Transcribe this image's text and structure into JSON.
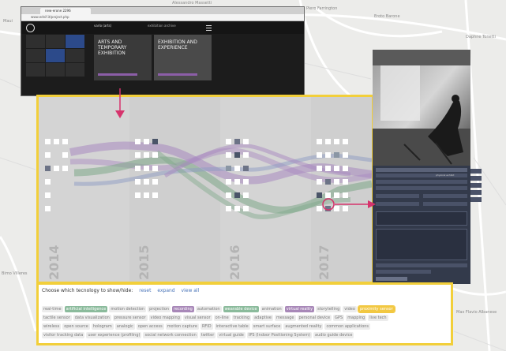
{
  "colors": {
    "highlight_yellow": "#f2cf3a",
    "pink_arrow": "#d6336c",
    "flow_purple": "#a888c0",
    "flow_green": "#7ea889",
    "flow_blue": "#8e9cc4"
  },
  "map": {
    "labels": [
      {
        "text": "Piero Farrington",
        "pos": "top-center"
      },
      {
        "text": "Eroto Barone",
        "pos": "top-right"
      },
      {
        "text": "Daphne Tonetti",
        "pos": "right"
      },
      {
        "text": "Maui",
        "pos": "left"
      },
      {
        "text": "Bimo Villeres",
        "pos": "left-middle"
      },
      {
        "text": "Max Flavio Albanese",
        "pos": "bottom-right"
      },
      {
        "text": "Alessandro Massetti",
        "pos": "top"
      }
    ]
  },
  "browser": {
    "tab_title": "new-erone 2296",
    "url": "www.ednif.it/project.php"
  },
  "site": {
    "title": "varlo (arts)",
    "subtitle": "exhibition archive",
    "features": [
      {
        "title": "ARTS AND TEMPORARY EXHIBITION"
      },
      {
        "title": "EXHIBITION AND EXPERIENCE"
      }
    ]
  },
  "viz": {
    "years": [
      "2014",
      "2015",
      "2016",
      "2017"
    ]
  },
  "detail": {
    "checkbox_label": "physical exhibit"
  },
  "filter": {
    "prompt": "Choose which tecnology to show/hide:",
    "reset": "reset",
    "expand": "expand",
    "view_all": "view all",
    "rows": [
      [
        {
          "label": "real-time",
          "state": ""
        },
        {
          "label": "artificial intelligence",
          "state": "on"
        },
        {
          "label": "motion detection",
          "state": ""
        },
        {
          "label": "projection",
          "state": ""
        },
        {
          "label": "recording",
          "state": "on-p"
        },
        {
          "label": "automation",
          "state": ""
        },
        {
          "label": "wearable device",
          "state": "on"
        },
        {
          "label": "animation",
          "state": ""
        },
        {
          "label": "virtual reality",
          "state": "on-p"
        },
        {
          "label": "storytelling",
          "state": ""
        },
        {
          "label": "video",
          "state": ""
        },
        {
          "label": "proximity sensor",
          "state": "on-y"
        }
      ],
      [
        {
          "label": "tactile sensor",
          "state": ""
        },
        {
          "label": "data visualization",
          "state": ""
        },
        {
          "label": "pressure sensor",
          "state": ""
        },
        {
          "label": "video mapping",
          "state": ""
        },
        {
          "label": "visual sensor",
          "state": ""
        },
        {
          "label": "on-line",
          "state": ""
        },
        {
          "label": "tracking",
          "state": ""
        },
        {
          "label": "adaptive",
          "state": ""
        },
        {
          "label": "message",
          "state": ""
        },
        {
          "label": "personal device",
          "state": ""
        },
        {
          "label": "GPS",
          "state": ""
        },
        {
          "label": "mapping",
          "state": ""
        },
        {
          "label": "live tech",
          "state": ""
        }
      ],
      [
        {
          "label": "wireless",
          "state": ""
        },
        {
          "label": "open source",
          "state": ""
        },
        {
          "label": "hologram",
          "state": ""
        },
        {
          "label": "analogic",
          "state": ""
        },
        {
          "label": "open access",
          "state": ""
        },
        {
          "label": "motion capture",
          "state": ""
        },
        {
          "label": "RFID",
          "state": ""
        },
        {
          "label": "interactive table",
          "state": ""
        },
        {
          "label": "smart surface",
          "state": ""
        },
        {
          "label": "augmented reality",
          "state": ""
        },
        {
          "label": "common applications",
          "state": ""
        }
      ],
      [
        {
          "label": "visitor tracking data",
          "state": ""
        },
        {
          "label": "user experience (profiling)",
          "state": ""
        },
        {
          "label": "social network connection",
          "state": ""
        },
        {
          "label": "twitter",
          "state": ""
        },
        {
          "label": "virtual guide",
          "state": ""
        },
        {
          "label": "IPS (Indoor Positioning System)",
          "state": ""
        },
        {
          "label": "audio guide device",
          "state": ""
        }
      ]
    ]
  }
}
